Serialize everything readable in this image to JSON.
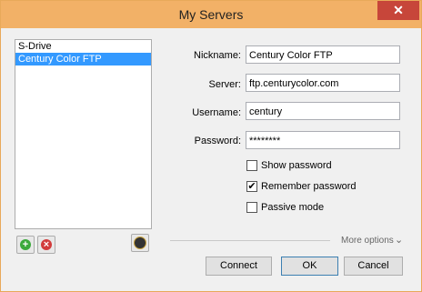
{
  "window": {
    "title": "My Servers",
    "close_glyph": "✕"
  },
  "servers": [
    {
      "label": "S-Drive",
      "selected": false
    },
    {
      "label": "Century Color FTP",
      "selected": true
    }
  ],
  "form": {
    "nickname_label": "Nickname:",
    "nickname_value": "Century Color FTP",
    "server_label": "Server:",
    "server_value": "ftp.centurycolor.com",
    "username_label": "Username:",
    "username_value": "century",
    "password_label": "Password:",
    "password_value": "********"
  },
  "options": {
    "show_password": {
      "label": "Show password",
      "checked": false
    },
    "remember_password": {
      "label": "Remember password",
      "checked": true
    },
    "passive_mode": {
      "label": "Passive mode",
      "checked": false
    }
  },
  "list_buttons": {
    "add_icon": "add-server-icon",
    "remove_icon": "remove-server-icon",
    "settings_icon": "server-settings-icon"
  },
  "more_options": {
    "label": "More options",
    "icon": "chevron-double-down-icon"
  },
  "buttons": {
    "connect": "Connect",
    "ok": "OK",
    "cancel": "Cancel"
  },
  "colors": {
    "titlebar": "#f2b167",
    "close": "#c7463a",
    "selection": "#3399ff",
    "add": "#3caa3c",
    "remove": "#d23c3c"
  }
}
